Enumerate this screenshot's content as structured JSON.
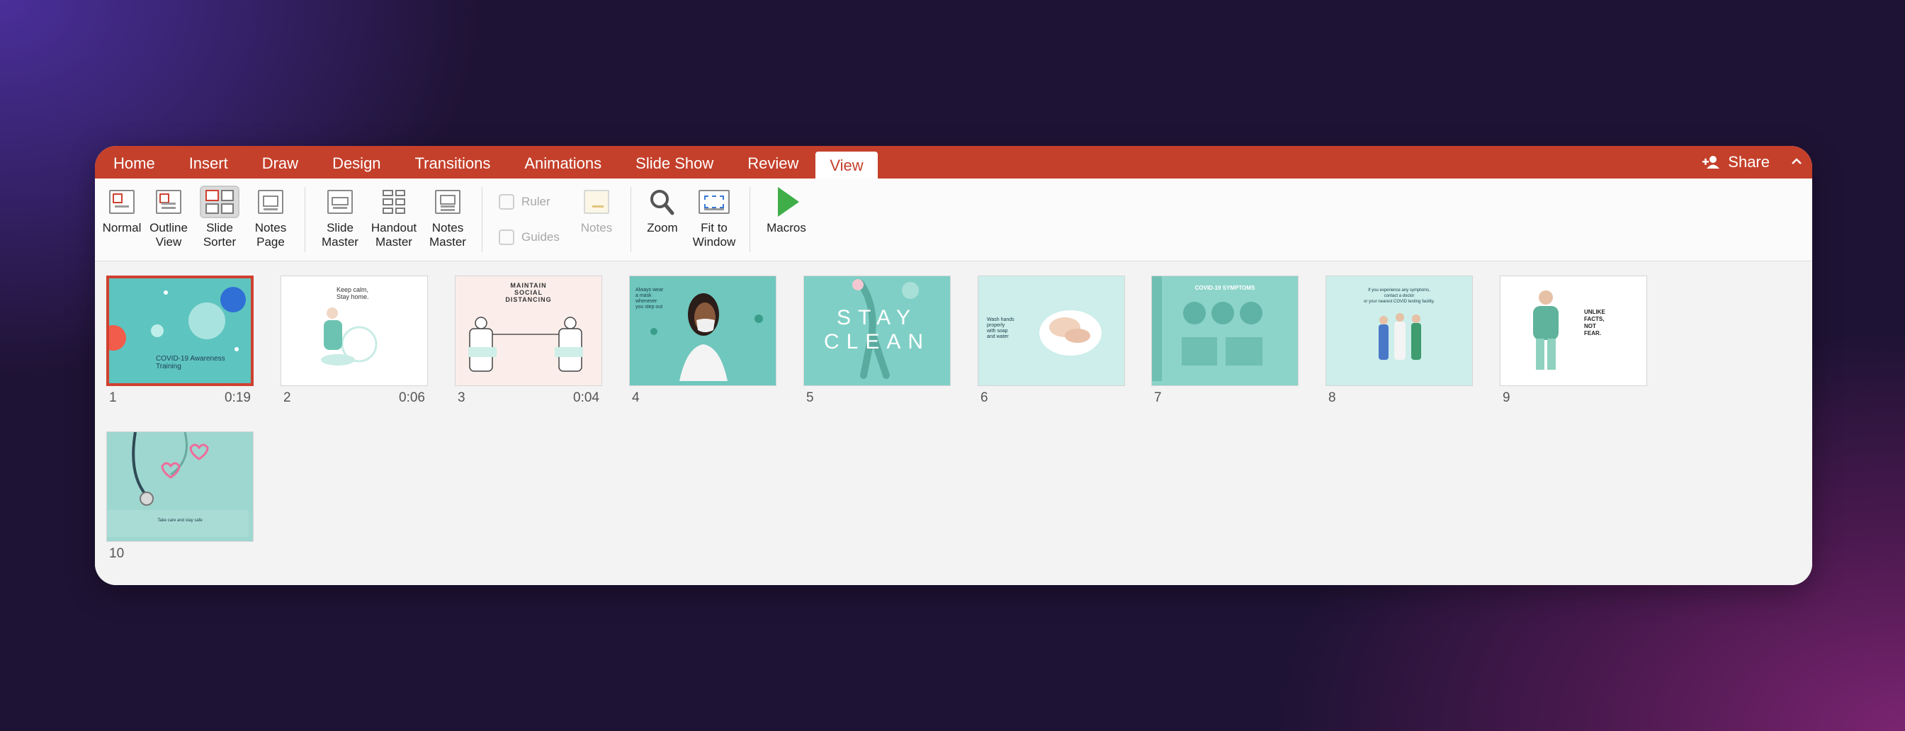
{
  "tabs": [
    "Home",
    "Insert",
    "Draw",
    "Design",
    "Transitions",
    "Animations",
    "Slide Show",
    "Review",
    "View"
  ],
  "active_tab": "View",
  "share_label": "Share",
  "ribbon": {
    "normal": "Normal",
    "outline": [
      "Outline",
      "View"
    ],
    "slide_sorter": [
      "Slide",
      "Sorter"
    ],
    "notes_page": [
      "Notes",
      "Page"
    ],
    "slide_master": [
      "Slide",
      "Master"
    ],
    "handout_master": [
      "Handout",
      "Master"
    ],
    "notes_master": [
      "Notes",
      "Master"
    ],
    "ruler": "Ruler",
    "guides": "Guides",
    "notes": "Notes",
    "zoom": "Zoom",
    "fit_to_window": [
      "Fit to",
      "Window"
    ],
    "macros": "Macros"
  },
  "slides": [
    {
      "number": "1",
      "time": "0:19",
      "text": [
        "COVID-19 Awareness",
        "Training"
      ]
    },
    {
      "number": "2",
      "time": "0:06",
      "text": [
        "Keep calm,",
        "Stay home."
      ]
    },
    {
      "number": "3",
      "time": "0:04",
      "text": [
        "MAINTAIN",
        "SOCIAL",
        "DISTANCING"
      ]
    },
    {
      "number": "4",
      "time": "",
      "text": [
        "Always wear",
        "a mask",
        "whenever",
        "you step out"
      ]
    },
    {
      "number": "5",
      "time": "",
      "text": [
        "STAY",
        "CLEAN"
      ]
    },
    {
      "number": "6",
      "time": "",
      "text": [
        "Wash hands",
        "properly",
        "with soap",
        "and water"
      ]
    },
    {
      "number": "7",
      "time": "",
      "text": [
        "COVID-19 SYMPTOMS"
      ]
    },
    {
      "number": "8",
      "time": "",
      "text": [
        "If you experience any symptoms,",
        "contact a doctor",
        "or your nearest COVID testing facility."
      ]
    },
    {
      "number": "9",
      "time": "",
      "text": [
        "UNLIKE",
        "FACTS,",
        "NOT",
        "FEAR."
      ]
    },
    {
      "number": "10",
      "time": "",
      "text": [
        "Take care and stay safe"
      ]
    }
  ],
  "colors": {
    "accent": "#c4402b",
    "selected_border": "#d04030",
    "slide_teal": "#7fcdc4",
    "background": "#1f1335"
  }
}
